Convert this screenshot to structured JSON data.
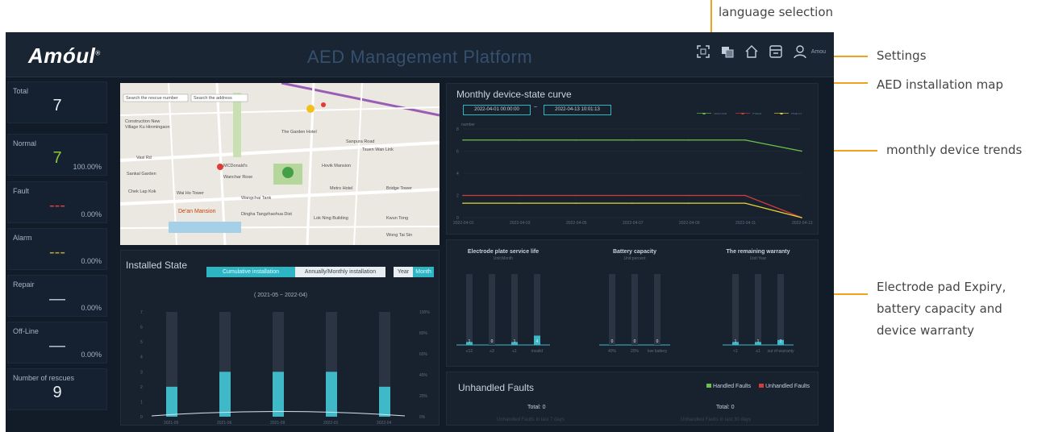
{
  "callouts": {
    "language": "language selection",
    "settings": "Settings",
    "map": "AED installation map",
    "trends": "monthly device trends",
    "expiry": [
      "Electrode pad Expiry,",
      "battery capacity and",
      "device warranty"
    ]
  },
  "header": {
    "logo": "Amóul",
    "logo_mark": "®",
    "title": "AED Management Platform",
    "user": "Amou"
  },
  "stats": [
    {
      "label": "Total",
      "value": "7",
      "pct": "",
      "color": "#e8edf2"
    },
    {
      "label": "Normal",
      "value": "7",
      "pct": "100.00%",
      "color": "#8fc63c"
    },
    {
      "label": "Fault",
      "value": "---",
      "pct": "0.00%",
      "color": "#d64040"
    },
    {
      "label": "Alarm",
      "value": "---",
      "pct": "0.00%",
      "color": "#b9a23a"
    },
    {
      "label": "Repair",
      "value": "—",
      "pct": "0.00%",
      "color": "#c7d2de"
    },
    {
      "label": "Off-Line",
      "value": "—",
      "pct": "0.00%",
      "color": "#c7d2de"
    },
    {
      "label": "Number of rescues",
      "value": "9",
      "pct": "",
      "color": "#e8edf2"
    }
  ],
  "map_labels": [
    "Search the rescue number",
    "Search the address",
    "Construction New",
    "Village Ku Hinmingaon",
    "Vasi Rd",
    "The Garden Hotel",
    "Sanpura Road",
    "Tsuen Wan Link",
    "Sankal Garden",
    "MCDonald's",
    "Hovik Mansion",
    "Wanchar Rose",
    "Wai Ho Tower",
    "Chek Lap Kok",
    "Wangchai Tank",
    "De'an Mansion",
    "Dingha Tangzhaohua Dist",
    "Lok Ning Building",
    "Kwun Tong",
    "Metro Hotel",
    "Bridge Tower",
    "Wong Tai Sin"
  ],
  "monthly": {
    "title": "Monthly device-state curve",
    "start": "2022-04-01 00:00:00",
    "sep": "~",
    "end": "2022-04-13 10:01:13",
    "legend": [
      "Normal",
      "Fault",
      "Alarm"
    ],
    "y_left_label": "number",
    "dates": [
      "2022-04-01",
      "2022-04-03",
      "2022-04-05",
      "2022-04-07",
      "2022-04-09",
      "2022-04-11",
      "2022-04-13"
    ]
  },
  "installed": {
    "title": "Installed State",
    "tabs": [
      "Cumulative installation",
      "Annually/Monthly installation"
    ],
    "period_tabs": [
      "Year",
      "Month"
    ],
    "range": "( 2021-05 ~ 2022-04)",
    "right_ticks": [
      "100%",
      "80%",
      "60%",
      "40%",
      "20%",
      "0%"
    ]
  },
  "expiry": {
    "charts": [
      {
        "title": "Electrode plate service life",
        "unit": "Unit:Month",
        "labels": [
          "≤12",
          "≤3",
          "≤1",
          "invalid"
        ],
        "values": [
          1,
          0,
          1,
          4
        ]
      },
      {
        "title": "Battery capacity",
        "unit": "Unit:percent",
        "labels": [
          "40%",
          "20%",
          "low battery"
        ],
        "values": [
          0,
          0,
          0
        ]
      },
      {
        "title": "The remaining warranty",
        "unit": "Unit:Year",
        "labels": [
          "<1",
          "≤1",
          "out of warranty"
        ],
        "values": [
          1,
          1,
          2
        ]
      }
    ]
  },
  "faults": {
    "title": "Unhandled Faults",
    "legend": [
      "Handled Faults",
      "Unhandled Faults"
    ],
    "totals": [
      "Total: 0",
      "Total: 0"
    ],
    "captions": [
      "Unhandled Faults in last 7 days",
      "Unhandled Faults in last 30 days"
    ]
  },
  "chart_data": [
    {
      "type": "line",
      "title": "Monthly device-state curve",
      "x": [
        "2022-04-01",
        "2022-04-03",
        "2022-04-05",
        "2022-04-07",
        "2022-04-09",
        "2022-04-11",
        "2022-04-13"
      ],
      "ylabel": "number",
      "ylim": [
        0,
        8
      ],
      "series": [
        {
          "name": "Normal",
          "color": "#6cc24a",
          "values": [
            7,
            7,
            7,
            7,
            7,
            7,
            6
          ]
        },
        {
          "name": "Fault",
          "color": "#d63a3a",
          "values": [
            2,
            2,
            2,
            2,
            2,
            2,
            0
          ]
        },
        {
          "name": "Alarm",
          "color": "#e6d23a",
          "values": [
            1.3,
            1.3,
            1.3,
            1.3,
            1.3,
            1.3,
            0
          ]
        }
      ]
    },
    {
      "type": "bar",
      "title": "Installed State",
      "categories": [
        "2021-05",
        "2021-06",
        "2021-09",
        "2022-01",
        "2022-04"
      ],
      "values": [
        2,
        3,
        3,
        3,
        2
      ],
      "ylim": [
        0,
        7
      ]
    }
  ]
}
